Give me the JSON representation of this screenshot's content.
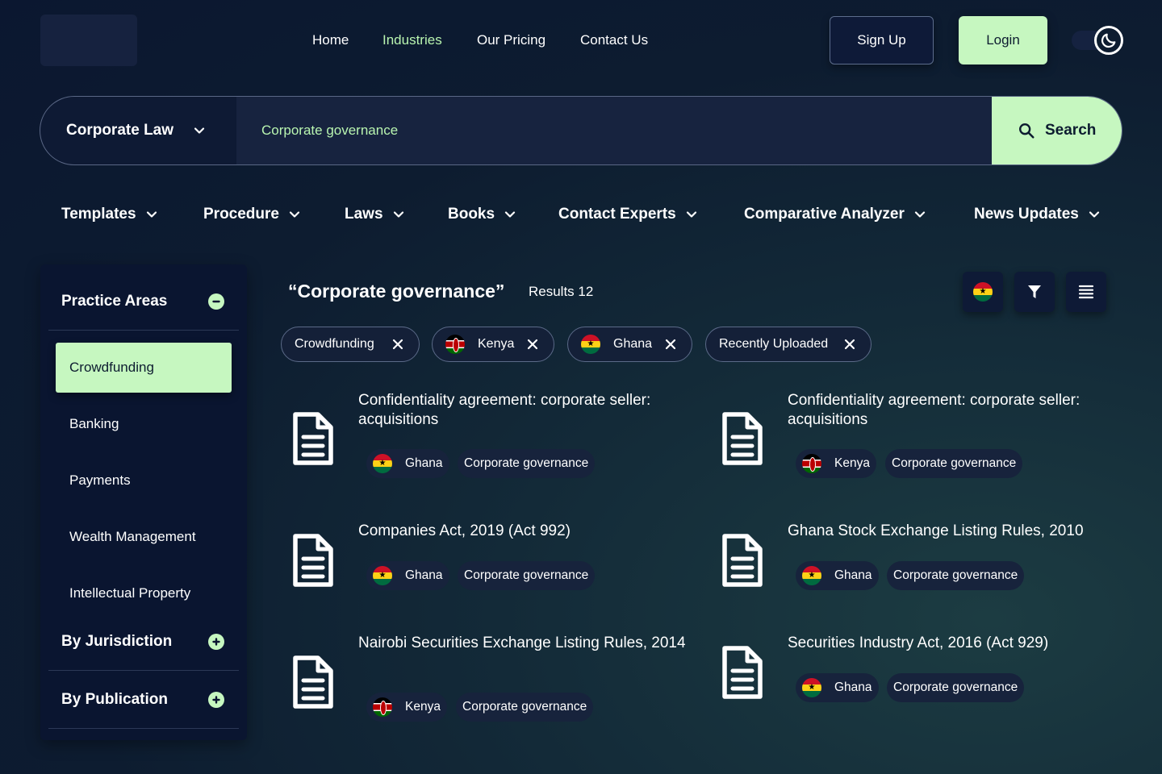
{
  "nav": {
    "links": [
      "Home",
      "Industries",
      "Our Pricing",
      "Contact Us"
    ],
    "active": "Industries",
    "signup": "Sign Up",
    "login": "Login"
  },
  "search": {
    "category": "Corporate Law",
    "query": "Corporate governance",
    "button": "Search"
  },
  "categories": [
    "Templates",
    "Procedure",
    "Laws",
    "Books",
    "Contact Experts",
    "Comparative Analyzer",
    "News Updates"
  ],
  "sidebar": {
    "practice_areas": "Practice Areas",
    "items": [
      "Crowdfunding",
      "Banking",
      "Payments",
      "Wealth Management",
      "Intellectual Property"
    ],
    "active_item": "Crowdfunding",
    "by_jurisdiction": "By Jurisdiction",
    "by_publication": "By Publication"
  },
  "results": {
    "query": "“Corporate governance”",
    "count": "Results 12",
    "filters": [
      {
        "label": "Crowdfunding",
        "flag": ""
      },
      {
        "label": "Kenya",
        "flag": "kenya-flag"
      },
      {
        "label": "Ghana",
        "flag": "ghana-flag"
      },
      {
        "label": "Recently Uploaded",
        "flag": ""
      }
    ],
    "items": [
      {
        "title": "Confidentiality agreement: corporate seller: acquisitions",
        "country": "Ghana",
        "tag": "Corporate governance"
      },
      {
        "title": "Confidentiality agreement: corporate seller: acquisitions",
        "country": "Kenya",
        "tag": "Corporate governance"
      },
      {
        "title": "Companies Act, 2019 (Act 992)",
        "country": "Ghana",
        "tag": "Corporate governance"
      },
      {
        "title": "Ghana Stock Exchange Listing Rules, 2010",
        "country": "Ghana",
        "tag": "Corporate governance"
      },
      {
        "title": "Nairobi Securities Exchange Listing Rules, 2014",
        "country": "Kenya",
        "tag": "Corporate governance"
      },
      {
        "title": "Securities Industry Act, 2016 (Act 929)",
        "country": "Ghana",
        "tag": "Corporate governance"
      }
    ]
  },
  "colors": {
    "accent": "#c6f7c0",
    "background": "#0b1730",
    "active_text": "#b9f5b0"
  }
}
